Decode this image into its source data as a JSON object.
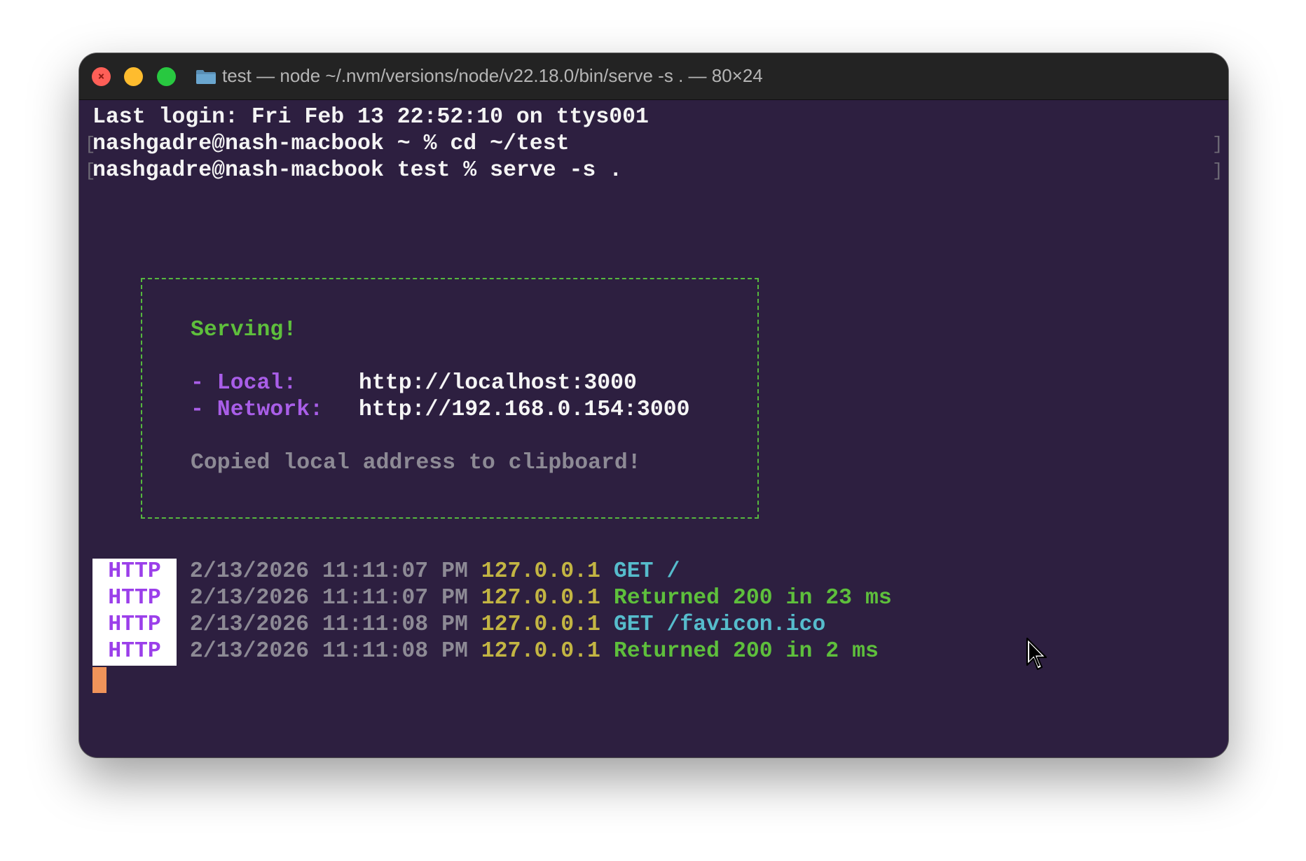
{
  "window": {
    "title": "test — node ~/.nvm/versions/node/v22.18.0/bin/serve -s . — 80×24"
  },
  "terminal": {
    "lines": [
      "Last login: Fri Feb 13 22:52:10 on ttys001",
      "nashgadre@nash-macbook ~ % cd ~/test",
      "nashgadre@nash-macbook test % serve -s ."
    ],
    "box": {
      "heading": "Serving!",
      "local_label": "- Local:",
      "local_url": "http://localhost:3000",
      "network_label": "- Network:",
      "network_url": "http://192.168.0.154:3000",
      "note": "Copied local address to clipboard!"
    },
    "logs": [
      {
        "tag": "HTTP",
        "time": "2/13/2026 11:11:07 PM",
        "ip": "127.0.0.1",
        "message": "GET /",
        "kind": "request"
      },
      {
        "tag": "HTTP",
        "time": "2/13/2026 11:11:07 PM",
        "ip": "127.0.0.1",
        "message": "Returned 200 in 23 ms",
        "kind": "response"
      },
      {
        "tag": "HTTP",
        "time": "2/13/2026 11:11:08 PM",
        "ip": "127.0.0.1",
        "message": "GET /favicon.ico",
        "kind": "request"
      },
      {
        "tag": "HTTP",
        "time": "2/13/2026 11:11:08 PM",
        "ip": "127.0.0.1",
        "message": "Returned 200 in 2 ms",
        "kind": "response"
      }
    ]
  },
  "colors": {
    "terminal_bg": "#2d1f40",
    "box_border": "#56b83e",
    "accent_purple": "#a95ee8",
    "ip_yellow": "#c3b543",
    "request_cyan": "#56bccc",
    "response_green": "#5ebf3c",
    "cursor": "#f0935a"
  },
  "icons": [
    "close-icon",
    "minimize-icon",
    "zoom-icon",
    "folder-icon",
    "mouse-pointer-icon"
  ]
}
